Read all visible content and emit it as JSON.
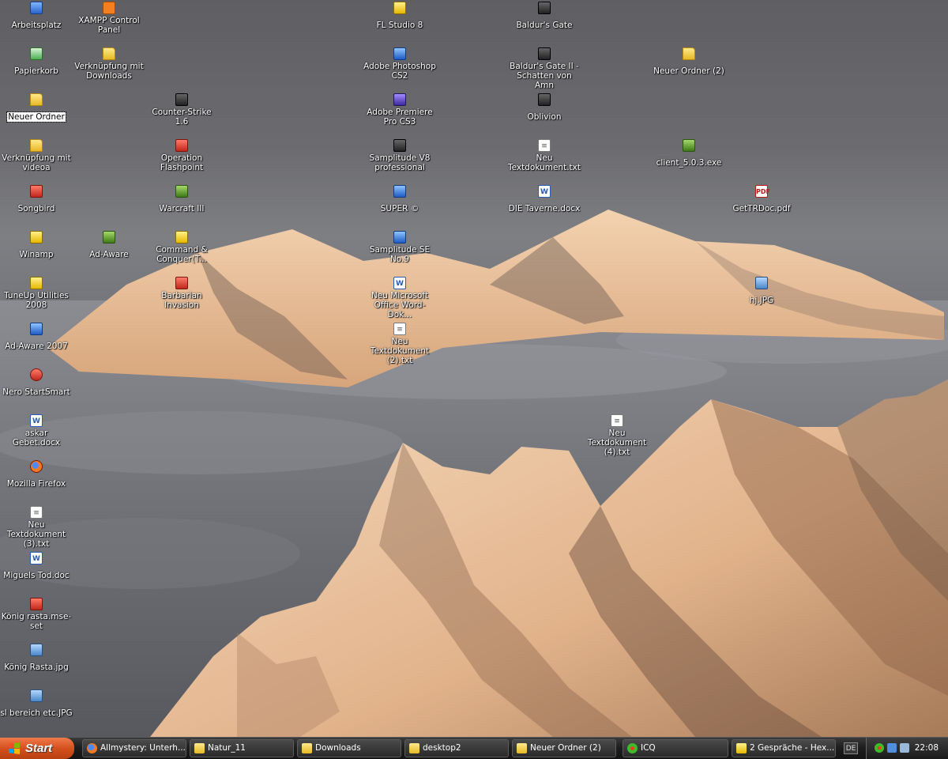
{
  "desktop_icons": [
    {
      "id": "arbeitsplatz",
      "label": "Arbeitsplatz",
      "icon": "computer-icon"
    },
    {
      "id": "papierkorb",
      "label": "Papierkorb",
      "icon": "recycle-bin-icon"
    },
    {
      "id": "neuer-ordner",
      "label": "Neuer Ordner",
      "icon": "folder-icon"
    },
    {
      "id": "verknuepfung-videoa",
      "label": "Verknüpfung mit videoa",
      "icon": "folder-shortcut-icon"
    },
    {
      "id": "songbird",
      "label": "Songbird",
      "icon": "songbird-icon"
    },
    {
      "id": "winamp",
      "label": "Winamp",
      "icon": "winamp-icon"
    },
    {
      "id": "tuneup",
      "label": "TuneUp Utilities 2008",
      "icon": "tuneup-icon"
    },
    {
      "id": "adaware-2007",
      "label": "Ad-Aware 2007",
      "icon": "adaware-icon"
    },
    {
      "id": "nero",
      "label": "Nero StartSmart",
      "icon": "nero-icon"
    },
    {
      "id": "askar-gebet",
      "label": "askar Gebet.docx",
      "icon": "word-document-icon"
    },
    {
      "id": "firefox",
      "label": "Mozilla Firefox",
      "icon": "firefox-icon"
    },
    {
      "id": "textdok-3",
      "label": "Neu Textdokument (3).txt",
      "icon": "text-file-icon"
    },
    {
      "id": "miguels-tod",
      "label": "Miguels Tod.doc",
      "icon": "word-document-icon"
    },
    {
      "id": "koenig-rasta-set",
      "label": "König rasta.mse-set",
      "icon": "mse-set-file-icon"
    },
    {
      "id": "koenig-rasta-jpg",
      "label": "König Rasta.jpg",
      "icon": "image-file-icon"
    },
    {
      "id": "sl-bereich",
      "label": "sl bereich etc.JPG",
      "icon": "image-file-icon"
    },
    {
      "id": "xampp",
      "label": "XAMPP Control Panel",
      "icon": "xampp-icon"
    },
    {
      "id": "verknuepfung-downloads",
      "label": "Verknüpfung mit Downloads",
      "icon": "folder-shortcut-icon"
    },
    {
      "id": "adaware",
      "label": "Ad-Aware",
      "icon": "adaware-icon"
    },
    {
      "id": "counter-strike",
      "label": "Counter-Strike 1.6",
      "icon": "counter-strike-icon"
    },
    {
      "id": "operation-flashpoint",
      "label": "Operation Flashpoint",
      "icon": "flashpoint-icon"
    },
    {
      "id": "warcraft",
      "label": "Warcraft III",
      "icon": "warcraft-icon"
    },
    {
      "id": "command-conquer",
      "label": "Command & Conquer(T...",
      "icon": "command-conquer-icon"
    },
    {
      "id": "barbarian",
      "label": "Barbarian Invasion",
      "icon": "barbarian-icon"
    },
    {
      "id": "fl-studio",
      "label": "FL Studio 8",
      "icon": "fl-studio-icon"
    },
    {
      "id": "photoshop",
      "label": "Adobe Photoshop CS2",
      "icon": "photoshop-icon"
    },
    {
      "id": "premiere",
      "label": "Adobe Premiere Pro CS3",
      "icon": "premiere-icon"
    },
    {
      "id": "samplitude-v8",
      "label": "Samplitude V8 professional",
      "icon": "samplitude-icon"
    },
    {
      "id": "super",
      "label": "SUPER ©",
      "icon": "super-icon"
    },
    {
      "id": "samplitude-se",
      "label": "Samplitude SE No.9",
      "icon": "samplitude-se-icon"
    },
    {
      "id": "word-dok",
      "label": "Neu Microsoft Office Word-Dok...",
      "icon": "word-document-icon"
    },
    {
      "id": "textdok-2",
      "label": "Neu Textdokument (2).txt",
      "icon": "text-file-icon"
    },
    {
      "id": "baldurs-gate",
      "label": "Baldur's Gate",
      "icon": "baldurs-gate-icon"
    },
    {
      "id": "baldurs-gate-2",
      "label": "Baldur's Gate II - Schatten von Amn",
      "icon": "baldurs-gate-2-icon"
    },
    {
      "id": "oblivion",
      "label": "Oblivion",
      "icon": "oblivion-icon"
    },
    {
      "id": "textdok",
      "label": "Neu Textdokument.txt",
      "icon": "text-file-icon"
    },
    {
      "id": "die-taverne",
      "label": "DIE Taverne.docx",
      "icon": "word-document-icon"
    },
    {
      "id": "textdok-4",
      "label": "Neu Textdokument (4).txt",
      "icon": "text-file-icon"
    },
    {
      "id": "neuer-ordner-2",
      "label": "Neuer Ordner (2)",
      "icon": "folder-icon"
    },
    {
      "id": "client",
      "label": "client_5.0.3.exe",
      "icon": "executable-icon"
    },
    {
      "id": "gettrdoc",
      "label": "GetTRDoc.pdf",
      "icon": "pdf-file-icon"
    },
    {
      "id": "hj-jpg",
      "label": "hj.JPG",
      "icon": "image-file-icon"
    }
  ],
  "taskbar": {
    "start_label": "Start",
    "tasks": [
      {
        "label": "Allmystery: Unterh...",
        "icon": "firefox-icon"
      },
      {
        "label": "Natur_11",
        "icon": "folder-icon"
      },
      {
        "label": "Downloads",
        "icon": "folder-icon"
      },
      {
        "label": "desktop2",
        "icon": "folder-icon"
      },
      {
        "label": "Neuer Ordner (2)",
        "icon": "folder-icon"
      },
      {
        "label": "ICQ",
        "icon": "icq-flower-icon"
      },
      {
        "label": "2 Gespräche - Hex...",
        "icon": "chat-window-icon"
      }
    ],
    "language": "DE",
    "clock": "22:08"
  },
  "colors": {
    "start_button": "#d5501e",
    "taskbar": "#1e1e1e",
    "icq_green": "#3dbb2a"
  }
}
